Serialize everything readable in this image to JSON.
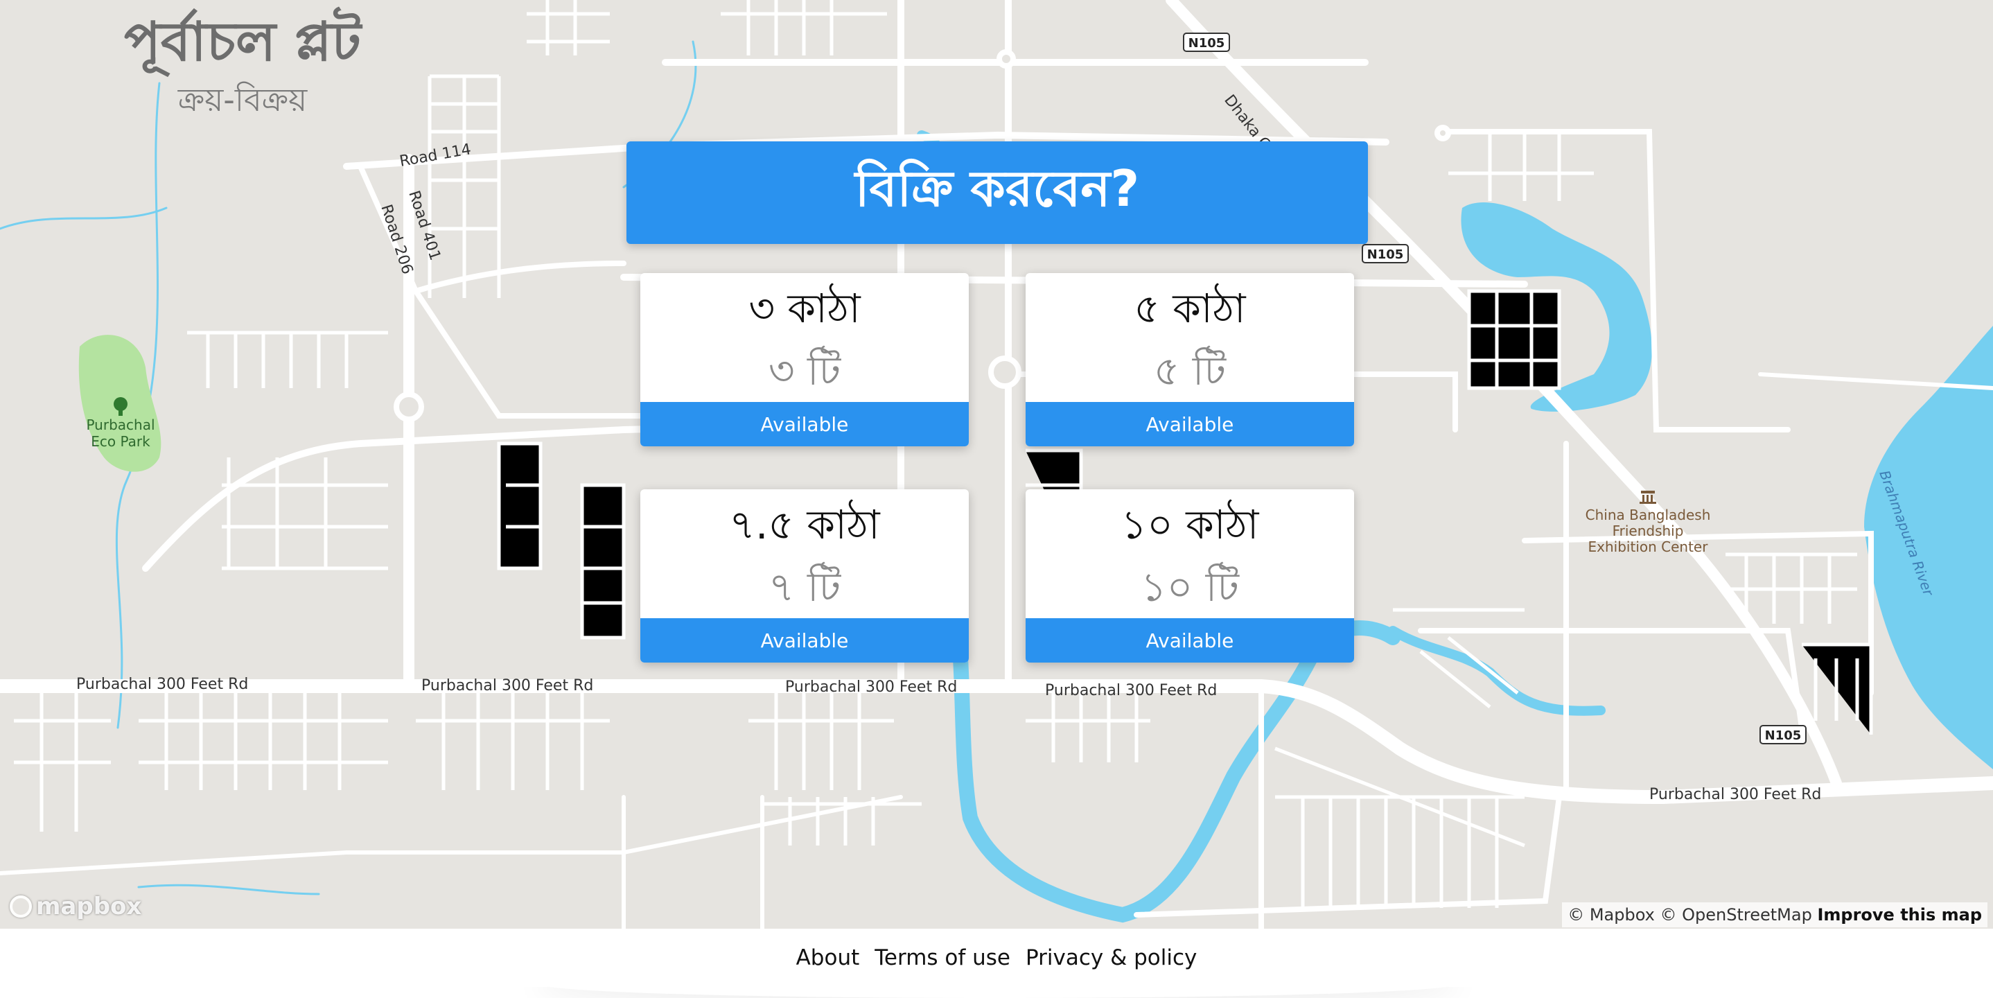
{
  "brand": {
    "title": "পূর্বাচল প্লট",
    "subtitle": "ক্রয়-বিক্রয়"
  },
  "sell_banner": {
    "label": "বিক্রি করবেন?"
  },
  "plots": [
    {
      "size": "৩ কাঠা",
      "count": "৩ টি",
      "status": "Available"
    },
    {
      "size": "৫ কাঠা",
      "count": "৫ টি",
      "status": "Available"
    },
    {
      "size": "৭.৫ কাঠা",
      "count": "৭ টি",
      "status": "Available"
    },
    {
      "size": "১০ কাঠা",
      "count": "১০ টি",
      "status": "Available"
    }
  ],
  "map": {
    "labels": {
      "road_114": "Road 114",
      "road_401": "Road 401",
      "road_206": "Road 206",
      "n105": "N105",
      "dhaka_city_bypass": "Dhaka City B",
      "purbachal_300": "Purbachal 300 Feet Rd",
      "eco_park_1": "Purbachal",
      "eco_park_2": "Eco Park",
      "china_1": "China Bangladesh",
      "china_2": "Friendship",
      "china_3": "Exhibition Center",
      "brahmaputra": "Brahmaputra River"
    },
    "colors": {
      "land": "#e6e4e0",
      "road": "#ffffff",
      "water": "#75cff0",
      "park": "#b4e3a0",
      "accent": "#2a92ef"
    }
  },
  "attribution": {
    "mapbox": "© Mapbox",
    "osm": "© OpenStreetMap",
    "improve": "Improve this map",
    "logo": "mapbox"
  },
  "footer": {
    "about": "About",
    "terms": "Terms of use",
    "privacy": "Privacy & policy"
  }
}
